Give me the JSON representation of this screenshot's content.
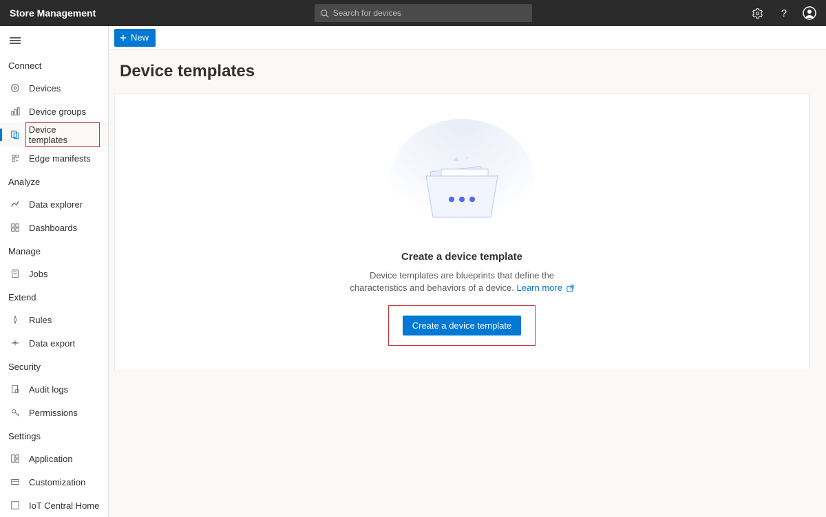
{
  "header": {
    "title": "Store Management",
    "search_placeholder": "Search for devices"
  },
  "toolbar": {
    "new_label": "New"
  },
  "page": {
    "heading": "Device templates"
  },
  "empty": {
    "title": "Create a device template",
    "description_pre": "Device templates are blueprints that define the characteristics and behaviors of a device. ",
    "learn_more": "Learn more",
    "button": "Create a device template"
  },
  "sidebar": {
    "sections": {
      "connect": "Connect",
      "analyze": "Analyze",
      "manage": "Manage",
      "extend": "Extend",
      "security": "Security",
      "settings": "Settings"
    },
    "items": {
      "devices": "Devices",
      "device_groups": "Device groups",
      "device_templates": "Device templates",
      "edge_manifests": "Edge manifests",
      "data_explorer": "Data explorer",
      "dashboards": "Dashboards",
      "jobs": "Jobs",
      "rules": "Rules",
      "data_export": "Data export",
      "audit_logs": "Audit logs",
      "permissions": "Permissions",
      "application": "Application",
      "customization": "Customization",
      "iot_central_home": "IoT Central Home"
    }
  }
}
